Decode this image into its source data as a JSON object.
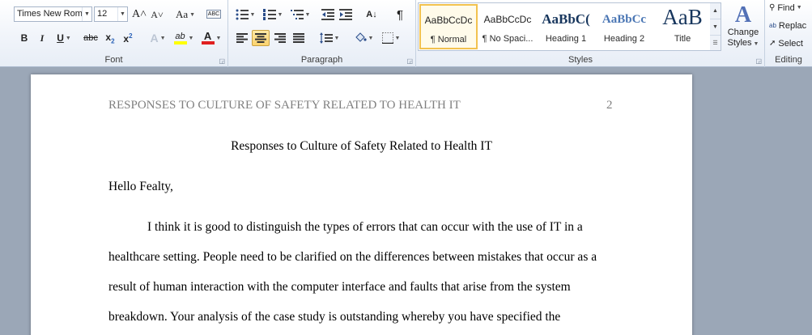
{
  "ribbon": {
    "font": {
      "label": "Font",
      "font_name": "Times New Rom",
      "font_size": "12",
      "grow_glyph": "A˄",
      "shrink_glyph": "A˅",
      "case_glyph": "Aa",
      "clear_glyph": "ABC",
      "bold": "B",
      "italic": "I",
      "underline": "U",
      "strike": "abc",
      "subscript_main": "x",
      "subscript_sub": "2",
      "superscript_main": "x",
      "superscript_sup": "2",
      "effects_glyph": "A",
      "highlight_glyph": "ab",
      "color_glyph": "A"
    },
    "paragraph": {
      "label": "Paragraph",
      "sort_glyph": "A↓",
      "pilcrow": "¶"
    },
    "styles": {
      "label": "Styles",
      "items": [
        {
          "sample": "AaBbCcDc",
          "name": "¶ Normal"
        },
        {
          "sample": "AaBbCcDc",
          "name": "¶ No Spaci..."
        },
        {
          "sample": "AaBbC(",
          "name": "Heading 1"
        },
        {
          "sample": "AaBbCc",
          "name": "Heading 2"
        },
        {
          "sample": "AaB",
          "name": "Title"
        }
      ],
      "change_styles_line1": "Change",
      "change_styles_line2": "Styles",
      "change_styles_glyph": "A"
    },
    "editing": {
      "label": "Editing",
      "find": "Find",
      "replace": "Replac",
      "select": "Select"
    }
  },
  "colors": {
    "highlight": "#ffff00",
    "font_color": "#e02020",
    "selected_style": "#f2c24f",
    "heading": "#17365d"
  },
  "document": {
    "header_text": "RESPONSES TO CULTURE OF SAFETY RELATED TO HEALTH IT",
    "page_number": "2",
    "title": "Responses to Culture of Safety Related to Health IT",
    "greeting": "Hello Fealty,",
    "lines": [
      "I think it is good to distinguish the types of errors that can occur with the use of IT in a",
      "healthcare setting. People need to be clarified on the differences between mistakes that occur as a",
      "result of human interaction with the computer interface and faults that arise from the system",
      "breakdown. Your analysis of the case study is outstanding whereby you have specified the"
    ]
  }
}
